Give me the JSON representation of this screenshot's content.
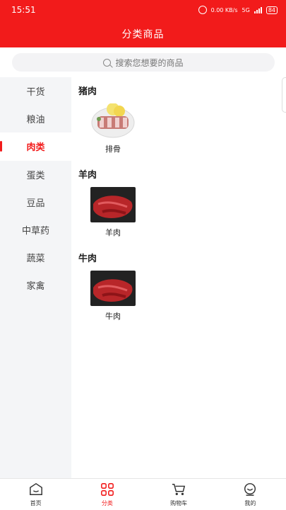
{
  "status": {
    "time": "15:51",
    "speed": "0.00\nKB/s",
    "network": "5G",
    "battery": "84"
  },
  "header": {
    "title": "分类商品"
  },
  "search": {
    "placeholder": "搜索您想要的商品"
  },
  "sidebar": {
    "items": [
      "干货",
      "粮油",
      "肉类",
      "蛋类",
      "豆品",
      "中草药",
      "蔬菜",
      "家禽"
    ],
    "active": "肉类"
  },
  "sections": [
    {
      "title": "猪肉",
      "product": "排骨",
      "image": "pork-ribs"
    },
    {
      "title": "羊肉",
      "product": "羊肉",
      "image": "raw-mutton"
    },
    {
      "title": "牛肉",
      "product": "牛肉",
      "image": "raw-beef"
    }
  ],
  "tabs": [
    {
      "label": "首页",
      "icon": "home-icon"
    },
    {
      "label": "分类",
      "icon": "category-grid-icon",
      "active": true
    },
    {
      "label": "购物车",
      "icon": "cart-icon"
    },
    {
      "label": "我的",
      "icon": "profile-icon"
    }
  ],
  "colors": {
    "accent": "#f21b1b",
    "sidebar": "#f4f5f7"
  }
}
